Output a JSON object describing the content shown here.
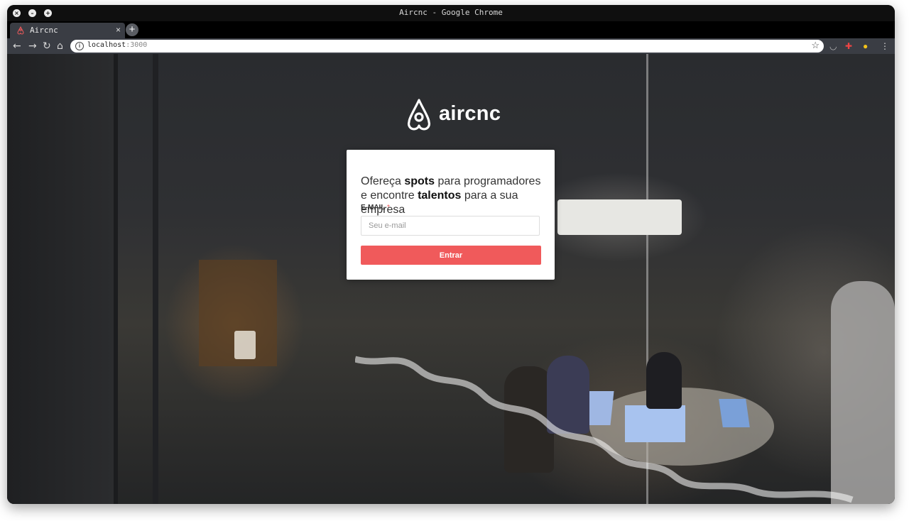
{
  "window": {
    "title": "Aircnc - Google Chrome",
    "controls": [
      "close-icon",
      "minimize-icon",
      "maximize-icon"
    ]
  },
  "tab": {
    "title": "Aircnc",
    "close_label": "×",
    "favicon": "airbnb-logo-icon"
  },
  "new_tab_label": "+",
  "address_bar": {
    "host": "localhost",
    "port": ":3000"
  },
  "logo": {
    "text": "aircnc",
    "icon": "airbnb-logo-icon",
    "color": "#ffffff"
  },
  "login": {
    "headline_part1": "Ofereça ",
    "headline_bold1": "spots",
    "headline_part2": " para programadores e encontre ",
    "headline_bold2": "talentos",
    "headline_part3": " para a sua empresa",
    "email_label": "E-MAIL",
    "required_mark": "*",
    "email_placeholder": "Seu e-mail",
    "email_value": "",
    "submit_label": "Entrar"
  },
  "colors": {
    "accent": "#f05a5b",
    "card_bg": "#ffffff",
    "browser_chrome": "#3a3d44"
  }
}
